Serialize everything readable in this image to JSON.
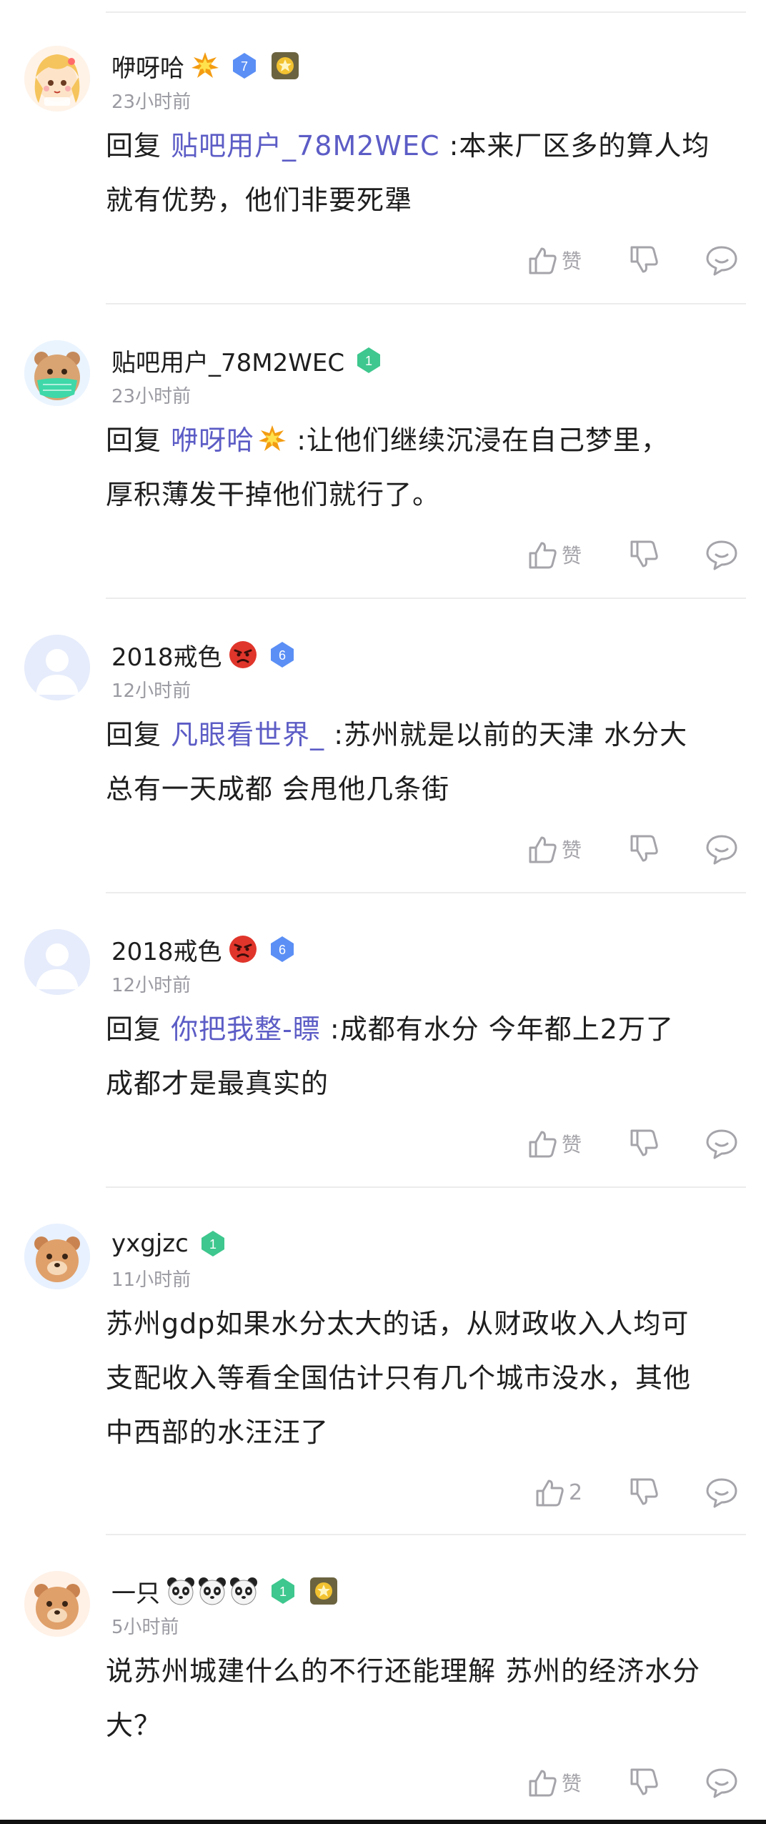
{
  "reply_prefix": "回复",
  "like_icon": "thumbs-up-icon",
  "dislike_icon": "thumbs-down-icon",
  "reply_icon": "comment-bubble-icon",
  "colors": {
    "reply_name": "#5c5cc6",
    "time": "#9a9aa2",
    "level_blue": "#5b8ff5",
    "level_green": "#3ec78e"
  },
  "comments": [
    {
      "username": "咿呀哈",
      "username_emoji": "boom-emoji",
      "level": "7",
      "time": "23小时前",
      "reply_to": "贴吧用户_78M2WEC",
      "text_line1": " :本来厂区多的算人均",
      "text_line2": "就有优势，他们非要死犟",
      "like_label": "赞"
    },
    {
      "username": "贴吧用户_78M2WEC",
      "level": "1",
      "time": "23小时前",
      "reply_to": "咿呀哈",
      "reply_to_emoji": "boom-emoji",
      "text_line1": " :让他们继续沉浸在自己梦里，",
      "text_line2": "厚积薄发干掉他们就行了。",
      "like_label": "赞"
    },
    {
      "username": "2018戒色",
      "username_emoji": "angry-face-emoji",
      "level": "6",
      "time": "12小时前",
      "reply_to": "凡眼看世界_",
      "text_line1": " :苏州就是以前的天津 水分大",
      "text_line2": "总有一天成都 会甩他几条街",
      "like_label": "赞"
    },
    {
      "username": "2018戒色",
      "username_emoji": "angry-face-emoji",
      "level": "6",
      "time": "12小时前",
      "reply_to": "你把我整-瞟",
      "text_line1": " :成都有水分 今年都上2万了",
      "text_line2": "成都才是最真实的",
      "like_label": "赞"
    },
    {
      "username": "yxgjzc",
      "level": "1",
      "time": "11小时前",
      "text_line1": "苏州gdp如果水分太大的话，从财政收入人均可",
      "text_line2": "支配收入等看全国估计只有几个城市没水，其他",
      "text_line3": "中西部的水汪汪了",
      "like_label": "2"
    },
    {
      "username": "一只",
      "username_emoji": "panda-face-emoji",
      "level": "1",
      "time": "5小时前",
      "text_line1": "说苏州城建什么的不行还能理解 苏州的经济水分",
      "text_line2": "大？",
      "like_label": "赞"
    }
  ]
}
